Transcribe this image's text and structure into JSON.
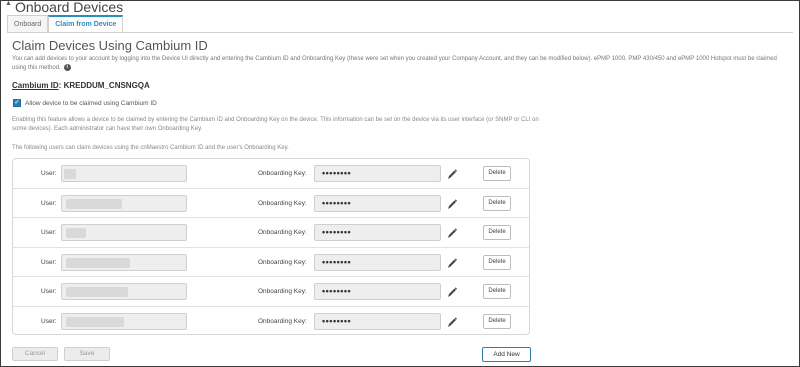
{
  "header": {
    "title": "Onboard Devices"
  },
  "tabs": [
    {
      "label": "Onboard",
      "active": false
    },
    {
      "label": "Claim from Device",
      "active": true
    }
  ],
  "section": {
    "title": "Claim Devices Using Cambium ID",
    "description": "You can add devices to your account by logging into the Device UI directly and entering the Cambium ID and Onboarding Key (these were set when you created your Company Account, and they can be modified below). ePMP 1000, PMP 430/450 and ePMP 1000 Hotspot must be claimed using this method."
  },
  "cambium": {
    "label": "Cambium ID",
    "separator": ":",
    "value": "KREDDUM_CNSNGQA"
  },
  "allow": {
    "label": "Allow device to be claimed using Cambium ID",
    "checked": true
  },
  "enabling_text": "Enabling this feature allows a device to be claimed by entering the Cambium ID and Onboarding Key on the device. This information can be set on the device via its user interface (or SNMP or CLI on some devices). Each administrator can have their own Onboarding Key.",
  "following_text": "The following users can claim devices using the cnMaestro Cambium ID and the user's Onboarding Key.",
  "user_rows": [
    {
      "user_label": "User:",
      "user_value": "",
      "key_label": "Onboarding Key:",
      "key_value": "••••••••",
      "delete_label": "Delete"
    },
    {
      "user_label": "User:",
      "user_value": "",
      "key_label": "Onboarding Key:",
      "key_value": "••••••••",
      "delete_label": "Delete"
    },
    {
      "user_label": "User:",
      "user_value": "",
      "key_label": "Onboarding Key:",
      "key_value": "••••••••",
      "delete_label": "Delete"
    },
    {
      "user_label": "User:",
      "user_value": "",
      "key_label": "Onboarding Key:",
      "key_value": "••••••••",
      "delete_label": "Delete"
    },
    {
      "user_label": "User:",
      "user_value": "",
      "key_label": "Onboarding Key:",
      "key_value": "••••••••",
      "delete_label": "Delete"
    },
    {
      "user_label": "User:",
      "user_value": "",
      "key_label": "Onboarding Key:",
      "key_value": "••••••••",
      "delete_label": "Delete"
    }
  ],
  "actions": {
    "cancel_label": "Cancel",
    "save_label": "Save",
    "add_new_label": "Add New"
  },
  "colors": {
    "accent": "#2a8fbd",
    "border": "#3a3a3a"
  }
}
